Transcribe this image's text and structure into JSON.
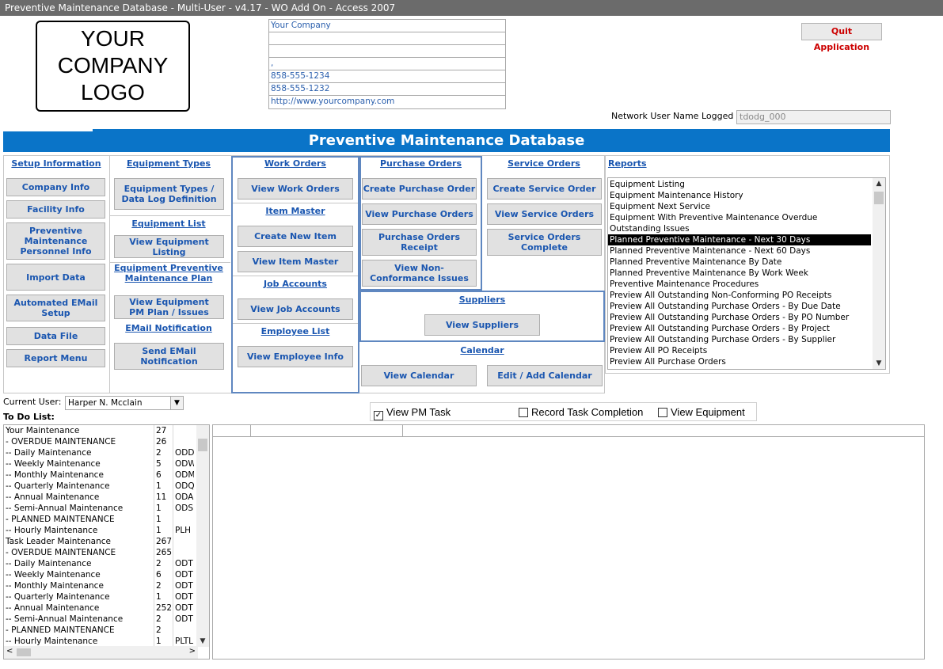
{
  "window": {
    "title": "Preventive Maintenance Database - Multi-User - v4.17 - WO Add On - Access 2007"
  },
  "logo": {
    "lines": [
      "YOUR",
      "COMPANY",
      "LOGO"
    ]
  },
  "company_info": [
    "Your Company",
    "",
    "",
    ",",
    "858-555-1234",
    "858-555-1232",
    "http://www.yourcompany.com"
  ],
  "quit_label": "Quit Application",
  "network": {
    "label": "Network User Name Logged in is",
    "value": "tdodg_000"
  },
  "banner_title": "Preventive Maintenance Database",
  "setup": {
    "header": "Setup Information",
    "buttons": [
      "Company Info",
      "Facility Info",
      "Preventive Maintenance Personnel Info",
      "Import Data",
      "Automated EMail Setup",
      "Data File",
      "Report Menu"
    ]
  },
  "equipment": {
    "types_header": "Equipment Types",
    "types_button": "Equipment Types / Data Log Definition",
    "list_header": "Equipment List",
    "list_button": "View Equipment Listing",
    "plan_header": "Equipment Preventive Maintenance Plan",
    "plan_button": "View Equipment PM Plan / Issues",
    "email_header": "EMail Notification",
    "email_button": "Send EMail Notification"
  },
  "work_orders": {
    "header": "Work Orders",
    "button": "View Work Orders",
    "item_header": "Item Master",
    "create_item": "Create New Item",
    "view_item": "View Item Master",
    "job_header": "Job Accounts",
    "job_button": "View Job Accounts",
    "emp_header": "Employee List",
    "emp_button": "View Employee Info"
  },
  "purchase_orders": {
    "header": "Purchase Orders",
    "buttons": [
      "Create Purchase Order",
      "View Purchase Orders",
      "Purchase Orders Receipt",
      "View Non-Conformance Issues"
    ]
  },
  "service_orders": {
    "header": "Service Orders",
    "buttons": [
      "Create Service Order",
      "View Service Orders",
      "Service Orders Complete"
    ]
  },
  "suppliers": {
    "header": "Suppliers",
    "button": "View Suppliers"
  },
  "calendar": {
    "header": "Calendar",
    "view_button": "View Calendar",
    "edit_button": "Edit / Add Calendar"
  },
  "reports": {
    "header": "Reports",
    "selected_index": 5,
    "items": [
      "Equipment Listing",
      "Equipment Maintenance History",
      "Equipment Next Service",
      "Equipment With Preventive Maintenance Overdue",
      "Outstanding Issues",
      "Planned Preventive Maintenance - Next 30 Days",
      "Planned Preventive Maintenance - Next 60 Days",
      "Planned Preventive Maintenance By Date",
      "Planned Preventive Maintenance By Work Week",
      "Preventive Maintenance Procedures",
      "Preview All Outstanding Non-Conforming PO Receipts",
      "Preview All Outstanding Purchase Orders - By Due Date",
      "Preview All Outstanding Purchase Orders - By PO Number",
      "Preview All Outstanding Purchase Orders - By Project",
      "Preview All Outstanding Purchase Orders - By Supplier",
      "Preview All PO Receipts",
      "Preview All Purchase Orders"
    ]
  },
  "current_user": {
    "label": "Current User:",
    "value": "Harper N. Mcclain"
  },
  "todo": {
    "label": "To Do List:",
    "rows": [
      [
        "Your Maintenance",
        "27",
        ""
      ],
      [
        " - OVERDUE MAINTENANCE",
        "26",
        ""
      ],
      [
        " -- Daily Maintenance",
        "2",
        "ODD"
      ],
      [
        " -- Weekly Maintenance",
        "5",
        "ODW"
      ],
      [
        " -- Monthly Maintenance",
        "6",
        "ODM"
      ],
      [
        " -- Quarterly Maintenance",
        "1",
        "ODQ"
      ],
      [
        " -- Annual Maintenance",
        "11",
        "ODA"
      ],
      [
        " -- Semi-Annual Maintenance",
        "1",
        "ODS"
      ],
      [
        " - PLANNED MAINTENANCE",
        "1",
        ""
      ],
      [
        " -- Hourly Maintenance",
        "1",
        "PLH"
      ],
      [
        "Task Leader Maintenance",
        "267",
        ""
      ],
      [
        " - OVERDUE MAINTENANCE",
        "265",
        ""
      ],
      [
        " -- Daily Maintenance",
        "2",
        "ODT"
      ],
      [
        " -- Weekly Maintenance",
        "6",
        "ODT"
      ],
      [
        " -- Monthly Maintenance",
        "2",
        "ODT"
      ],
      [
        " -- Quarterly Maintenance",
        "1",
        "ODT"
      ],
      [
        " -- Annual Maintenance",
        "252",
        "ODT"
      ],
      [
        " -- Semi-Annual Maintenance",
        "2",
        "ODT"
      ],
      [
        " - PLANNED MAINTENANCE",
        "2",
        ""
      ],
      [
        " -- Hourly Maintenance",
        "1",
        "PLTL"
      ]
    ]
  },
  "view_options": [
    {
      "label": "View PM Task",
      "checked": true
    },
    {
      "label": "Record Task Completion",
      "checked": false
    },
    {
      "label": "View Equipment",
      "checked": false
    }
  ]
}
